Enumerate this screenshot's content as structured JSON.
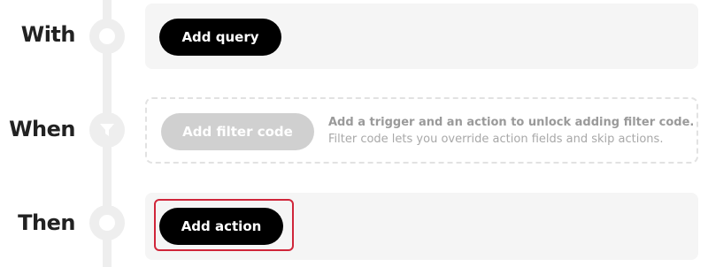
{
  "steps": {
    "with": {
      "label": "With",
      "button_label": "Add query"
    },
    "when": {
      "label": "When",
      "button_label": "Add filter code",
      "hint_title": "Add a trigger and an action to unlock adding filter code.",
      "hint_subtitle": "Filter code lets you override action fields and skip actions."
    },
    "then": {
      "label": "Then",
      "button_label": "Add action"
    }
  },
  "colors": {
    "highlight": "#d0263a",
    "button_bg": "#000000",
    "button_disabled_bg": "#d0d0d0",
    "rail": "#eeeeee",
    "panel_bg": "#f5f5f5"
  },
  "icons": {
    "with_node": "circle-node-icon",
    "when_node": "funnel-icon",
    "then_node": "circle-node-icon"
  }
}
